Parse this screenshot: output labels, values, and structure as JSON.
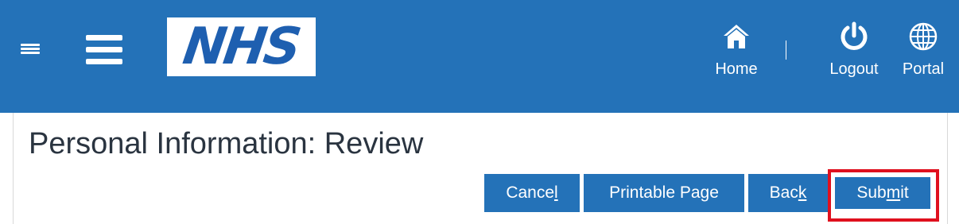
{
  "header": {
    "logo_text": "NHS",
    "nav": {
      "home_label": "Home",
      "logout_label": "Logout",
      "portal_label": "Portal"
    },
    "icons": {
      "menu_small": "hamburger-icon",
      "menu_large": "hamburger-icon",
      "home": "home-icon",
      "logout": "power-icon",
      "portal": "globe-icon"
    },
    "colors": {
      "header_bg": "#2472b8",
      "logo_text": "#1e5fb0"
    }
  },
  "page": {
    "title": "Personal Information: Review"
  },
  "actions": {
    "cancel": {
      "before": "Cance",
      "access_key": "l",
      "after": ""
    },
    "printable": {
      "label": "Printable Page"
    },
    "back": {
      "before": "Bac",
      "access_key": "k",
      "after": ""
    },
    "submit": {
      "before": "Sub",
      "access_key": "m",
      "after": "it"
    },
    "highlight_color": "#e0101e"
  }
}
